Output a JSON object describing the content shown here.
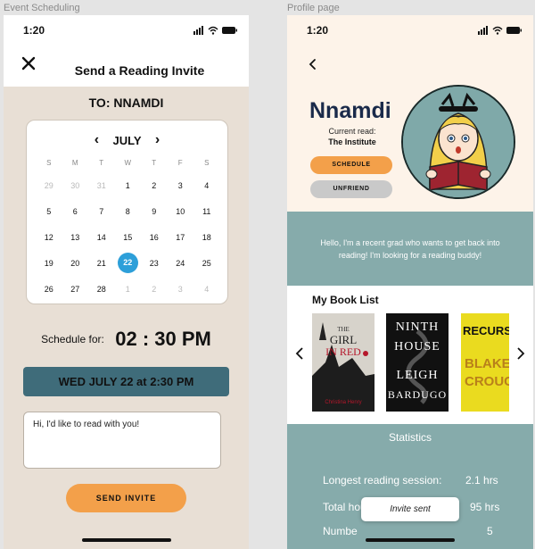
{
  "frames": {
    "left_label": "Event Scheduling",
    "right_label": "Profile page"
  },
  "status_bar": {
    "time": "1:20"
  },
  "invite": {
    "title": "Send a Reading Invite",
    "to_line": "TO: NNAMDI",
    "calendar": {
      "month": "JULY",
      "weekdays": [
        "S",
        "M",
        "T",
        "W",
        "T",
        "F",
        "S"
      ],
      "weeks": [
        [
          {
            "d": "29",
            "muted": true
          },
          {
            "d": "30",
            "muted": true
          },
          {
            "d": "31",
            "muted": true
          },
          {
            "d": "1"
          },
          {
            "d": "2"
          },
          {
            "d": "3"
          },
          {
            "d": "4"
          }
        ],
        [
          {
            "d": "5"
          },
          {
            "d": "6"
          },
          {
            "d": "7"
          },
          {
            "d": "8"
          },
          {
            "d": "9"
          },
          {
            "d": "10"
          },
          {
            "d": "11"
          }
        ],
        [
          {
            "d": "12"
          },
          {
            "d": "13"
          },
          {
            "d": "14"
          },
          {
            "d": "15"
          },
          {
            "d": "16"
          },
          {
            "d": "17"
          },
          {
            "d": "18"
          }
        ],
        [
          {
            "d": "19"
          },
          {
            "d": "20"
          },
          {
            "d": "21"
          },
          {
            "d": "22",
            "selected": true
          },
          {
            "d": "23"
          },
          {
            "d": "24"
          },
          {
            "d": "25"
          }
        ],
        [
          {
            "d": "26"
          },
          {
            "d": "27"
          },
          {
            "d": "28"
          },
          {
            "d": "1",
            "muted": true
          },
          {
            "d": "2",
            "muted": true
          },
          {
            "d": "3",
            "muted": true
          },
          {
            "d": "4",
            "muted": true
          }
        ]
      ]
    },
    "schedule_label": "Schedule for:",
    "schedule_time": "02 : 30 PM",
    "date_banner": "WED JULY 22 at 2:30 PM",
    "message": "Hi, I'd like to read with you!",
    "send_button": "SEND INVITE"
  },
  "profile": {
    "name": "Nnamdi",
    "current_read_label": "Current read:",
    "current_read_title": "The Institute",
    "schedule_button": "SCHEDULE",
    "unfriend_button": "UNFRIEND",
    "bio": "Hello, I'm a recent grad who wants to get back into reading! I'm looking for a reading buddy!",
    "book_list_title": "My Book List",
    "books": [
      {
        "title_line1": "THE",
        "title_line2": "GIRL",
        "title_line3": "IN RED",
        "author": "Christina Henry"
      },
      {
        "title_line1": "NINTH",
        "title_line2": "HOUSE",
        "title_line3": "LEIGH",
        "title_line4": "BARDUGO"
      },
      {
        "title_line1": "RECURSI",
        "title_line2": "BLAKE",
        "title_line3": "CROUC"
      }
    ],
    "stats_title": "Statistics",
    "stats": [
      {
        "label": "Longest reading session:",
        "value": "2.1 hrs"
      },
      {
        "label": "Total hours spent reading:",
        "value": "95 hrs"
      },
      {
        "label": "Numbe",
        "value": "5"
      }
    ],
    "toast": "Invite sent"
  },
  "colors": {
    "accent_orange": "#f3a04a",
    "selected_day": "#2d9fd9",
    "banner_teal": "#3f6c7a",
    "band_teal": "#86abab",
    "name_navy": "#1a2a4a"
  }
}
